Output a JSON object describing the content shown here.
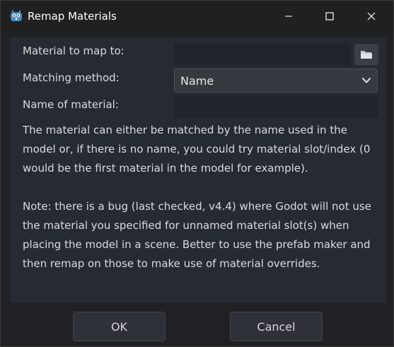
{
  "window": {
    "title": "Remap Materials",
    "icons": {
      "app": "godot-icon",
      "minimize": "minimize-icon",
      "maximize": "maximize-icon",
      "close": "close-icon"
    }
  },
  "form": {
    "material_label": "Material to map to:",
    "material_value": "",
    "browse_icon": "folder-icon",
    "method_label": "Matching method:",
    "method_value": "Name",
    "name_label": "Name of material:",
    "name_value": ""
  },
  "help": {
    "paragraph1": "The material can either be matched by the name used in the model or, if there is no name, you could try material slot/index (0 would be the first material in the model for example).",
    "paragraph2": "Note: there is a bug (last checked, v4.4) where Godot will not use the material you specified for unnamed material slot(s) when placing the model in a scene. Better to use the prefab maker and then remap on those to make use of material overrides."
  },
  "buttons": {
    "ok": "OK",
    "cancel": "Cancel"
  },
  "colors": {
    "accent": "#478cbf",
    "panel": "#262b33",
    "text": "#d9dadc"
  }
}
